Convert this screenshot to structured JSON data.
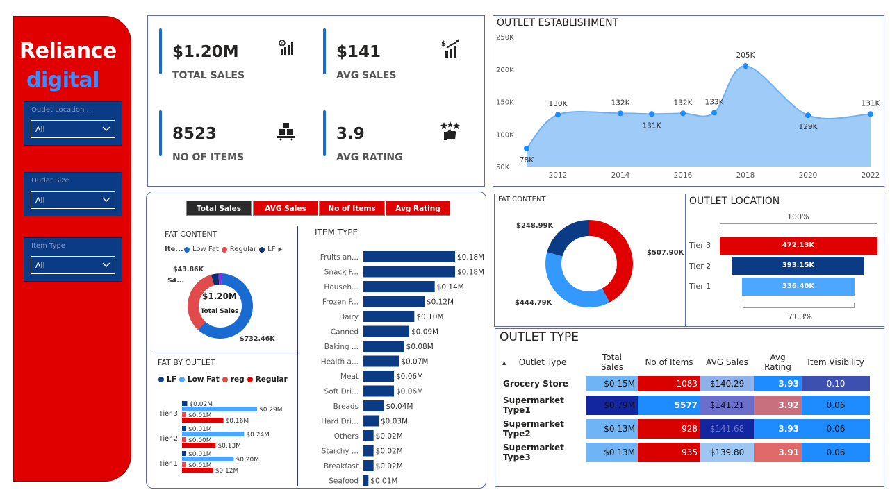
{
  "brand": {
    "line1": "Reliance",
    "line2": "digital"
  },
  "slicers": [
    {
      "label": "Outlet Location ...",
      "value": "All"
    },
    {
      "label": "Outlet Size",
      "value": "All"
    },
    {
      "label": "Item Type",
      "value": "All"
    }
  ],
  "kpis": [
    {
      "value": "$1.20M",
      "label": "TOTAL SALES",
      "icon": "sales-chart-icon"
    },
    {
      "value": "$141",
      "label": "AVG SALES",
      "icon": "growth-chart-icon"
    },
    {
      "value": "8523",
      "label": "NO OF ITEMS",
      "icon": "boxes-icon"
    },
    {
      "value": "3.9",
      "label": "AVG RATING",
      "icon": "thumbs-up-stars-icon"
    }
  ],
  "tabs": [
    "Total Sales",
    "AVG Sales",
    "No of Items",
    "Avg Rating"
  ],
  "fat_content_small": {
    "title": "FAT CONTENT",
    "legend_title": "Ite...",
    "legend": [
      "Low Fat",
      "Regular",
      "LF"
    ],
    "center_value": "$1.20M",
    "center_label": "Total Sales",
    "labels": [
      "$43.86K",
      "$4...",
      "$732.46K"
    ]
  },
  "fat_by_outlet": {
    "title": "FAT BY OUTLET",
    "legend": [
      "LF",
      "Low Fat",
      "reg",
      "Regular"
    ],
    "tiers": [
      {
        "name": "Tier 3",
        "labels": [
          "$0.02M",
          "$0.29M",
          "$0.01M",
          "$0.16M"
        ]
      },
      {
        "name": "Tier 2",
        "labels": [
          "$0.01M",
          "$0.24M",
          "$0.00M",
          "$0.13M"
        ]
      },
      {
        "name": "Tier 1",
        "labels": [
          "$0.01M",
          "$0.20M",
          "$0.01M",
          "$0.12M"
        ]
      }
    ]
  },
  "item_type": {
    "title": "ITEM TYPE",
    "rows": [
      {
        "name": "Fruits an...",
        "label": "$0.18M"
      },
      {
        "name": "Snack F...",
        "label": "$0.18M"
      },
      {
        "name": "Househ...",
        "label": "$0.14M"
      },
      {
        "name": "Frozen F...",
        "label": "$0.12M"
      },
      {
        "name": "Dairy",
        "label": "$0.10M"
      },
      {
        "name": "Canned",
        "label": "$0.09M"
      },
      {
        "name": "Baking ...",
        "label": "$0.08M"
      },
      {
        "name": "Health a...",
        "label": "$0.07M"
      },
      {
        "name": "Meat",
        "label": "$0.06M"
      },
      {
        "name": "Soft Dri...",
        "label": "$0.06M"
      },
      {
        "name": "Breads",
        "label": "$0.04M"
      },
      {
        "name": "Hard Dri...",
        "label": "$0.03M"
      },
      {
        "name": "Others",
        "label": "$0.02M"
      },
      {
        "name": "Starchy ...",
        "label": "$0.02M"
      },
      {
        "name": "Breakfast",
        "label": "$0.02M"
      },
      {
        "name": "Seafood",
        "label": "$0.01M"
      }
    ]
  },
  "outlet_establishment": {
    "title": "OUTLET ESTABLISHMENT",
    "yticks": [
      "250K",
      "200K",
      "150K",
      "100K",
      "50K"
    ],
    "xticks": [
      "2012",
      "2014",
      "2016",
      "2018",
      "2020",
      "2022"
    ],
    "labels": [
      "78K",
      "130K",
      "132K",
      "131K",
      "132K",
      "133K",
      "205K",
      "129K",
      "131K"
    ]
  },
  "fat_content_right": {
    "title": "FAT CONTENT",
    "labels": [
      "$248.99K",
      "$507.90K",
      "$444.79K"
    ]
  },
  "outlet_location": {
    "title": "OUTLET LOCATION",
    "top_pct": "100%",
    "bottom_pct": "71.3%",
    "tiers": [
      {
        "name": "Tier 3",
        "label": "472.13K"
      },
      {
        "name": "Tier 2",
        "label": "393.15K"
      },
      {
        "name": "Tier 1",
        "label": "336.40K"
      }
    ]
  },
  "outlet_type": {
    "title": "OUTLET TYPE",
    "headers": [
      "Outlet Type",
      "Total Sales",
      "No of Items",
      "AVG Sales",
      "Avg Rating",
      "Item Visibility"
    ],
    "rows": [
      {
        "name": "Grocery Store",
        "cells": [
          "$0.15M",
          "1083",
          "$140.29",
          "3.93",
          "0.10"
        ]
      },
      {
        "name": "Supermarket Type1",
        "cells": [
          "$0.79M",
          "5577",
          "$141.21",
          "3.92",
          "0.06"
        ]
      },
      {
        "name": "Supermarket Type2",
        "cells": [
          "$0.13M",
          "928",
          "$141.68",
          "3.93",
          "0.06"
        ]
      },
      {
        "name": "Supermarket Type3",
        "cells": [
          "$0.13M",
          "935",
          "$139.80",
          "3.91",
          "0.06"
        ]
      }
    ]
  },
  "chart_data": [
    {
      "type": "area",
      "title": "OUTLET ESTABLISHMENT",
      "x": [
        2011,
        2012,
        2014,
        2015,
        2016,
        2017,
        2018,
        2020,
        2022
      ],
      "series": [
        {
          "values": [
            78,
            130,
            132,
            131,
            132,
            133,
            205,
            129,
            131
          ]
        }
      ],
      "ylim": [
        50,
        250
      ],
      "xlim": [
        2011,
        2022
      ],
      "grid": false,
      "color": "#9ecbf7"
    },
    {
      "type": "bar",
      "title": "ITEM TYPE",
      "orientation": "horizontal",
      "categories": [
        "Fruits an...",
        "Snack F...",
        "Househ...",
        "Frozen F...",
        "Dairy",
        "Canned",
        "Baking ...",
        "Health a...",
        "Meat",
        "Soft Dri...",
        "Breads",
        "Hard Dri...",
        "Others",
        "Starchy ...",
        "Breakfast",
        "Seafood"
      ],
      "values": [
        0.18,
        0.18,
        0.14,
        0.12,
        0.1,
        0.09,
        0.08,
        0.07,
        0.06,
        0.06,
        0.04,
        0.03,
        0.02,
        0.02,
        0.02,
        0.01
      ],
      "color": "#0c3b86"
    },
    {
      "type": "pie",
      "title": "FAT CONTENT",
      "categories": [
        "Low Fat",
        "Regular",
        "LF",
        "reg"
      ],
      "values": [
        732.46,
        400,
        43.86,
        20
      ],
      "colors": [
        "#1a6bd1",
        "#e24b4b",
        "#0c2f6e",
        "#8a2be2"
      ]
    },
    {
      "type": "pie",
      "title": "FAT CONTENT",
      "values": [
        507.9,
        444.79,
        248.99
      ],
      "colors": [
        "#e00000",
        "#3399ff",
        "#0c3b86"
      ]
    },
    {
      "type": "bar",
      "title": "OUTLET LOCATION",
      "categories": [
        "Tier 3",
        "Tier 2",
        "Tier 1"
      ],
      "values": [
        472.13,
        393.15,
        336.4
      ],
      "colors": [
        "#e00000",
        "#0c3b86",
        "#4da6ff"
      ]
    },
    {
      "type": "bar",
      "title": "FAT BY OUTLET",
      "orientation": "horizontal",
      "categories": [
        "Tier 3",
        "Tier 2",
        "Tier 1"
      ],
      "series": [
        {
          "name": "LF",
          "values": [
            0.02,
            0.01,
            0.01
          ]
        },
        {
          "name": "Low Fat",
          "values": [
            0.29,
            0.24,
            0.2
          ]
        },
        {
          "name": "reg",
          "values": [
            0.01,
            0.0,
            0.01
          ]
        },
        {
          "name": "Regular",
          "values": [
            0.16,
            0.13,
            0.12
          ]
        }
      ],
      "colors": [
        "#0c3b86",
        "#4da6ff",
        "#e24b4b",
        "#e00000"
      ]
    }
  ],
  "colors": {
    "brand_red": "#e00000",
    "navy": "#0c3b86",
    "light_blue": "#9ecbf7",
    "accent_blue": "#1a6bd1"
  }
}
